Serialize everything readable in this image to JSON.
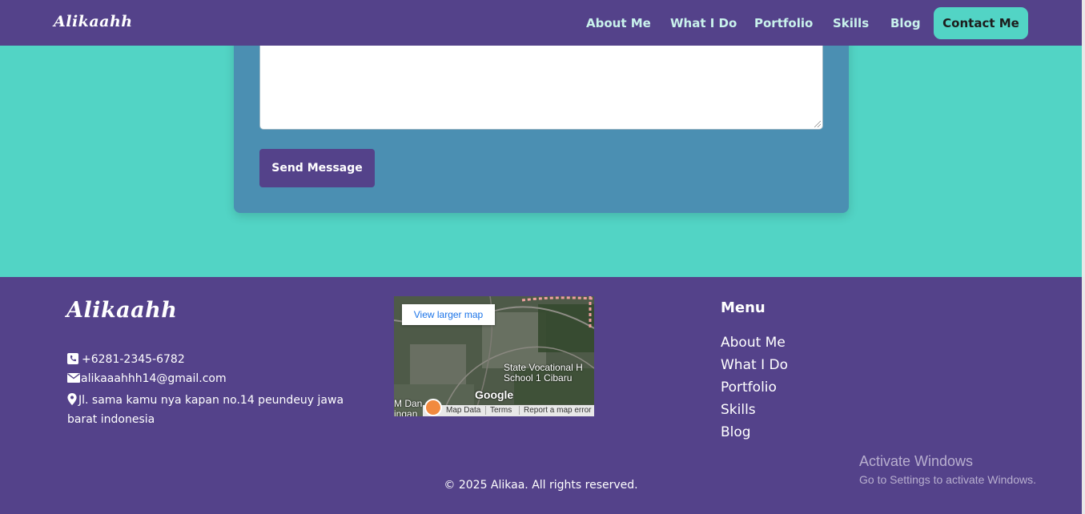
{
  "nav": {
    "brand": "Alikaahh",
    "links": [
      "About Me",
      "What I Do",
      "Portfolio",
      "Skills",
      "Blog"
    ],
    "cta": "Contact Me"
  },
  "contact_form": {
    "send_label": "Send Message"
  },
  "footer": {
    "brand": "Alikaahh",
    "phone": "+6281-2345-6782",
    "email": "alikaaahhh14@gmail.com",
    "address": "Jl. sama kamu nya kapan no.14 peundeuy jawa barat indonesia",
    "map": {
      "larger_link": "View larger map",
      "place_label": "State Vocational H School 1 Cibaru",
      "edge_label_1": "M Dan",
      "edge_label_2": "ingan",
      "logo": "Google",
      "bar": [
        "Map Data",
        "Terms",
        "Report a map error"
      ]
    },
    "menu": {
      "title": "Menu",
      "items": [
        "About Me",
        "What I Do",
        "Portfolio",
        "Skills",
        "Blog"
      ]
    },
    "copyright": "© 2025 Alikaa. All rights reserved."
  },
  "os_watermark": {
    "line1": "Activate Windows",
    "line2": "Go to Settings to activate Windows."
  },
  "colors": {
    "accent": "#52d4c5",
    "primary": "#54428a",
    "card": "#4b8fb2"
  }
}
